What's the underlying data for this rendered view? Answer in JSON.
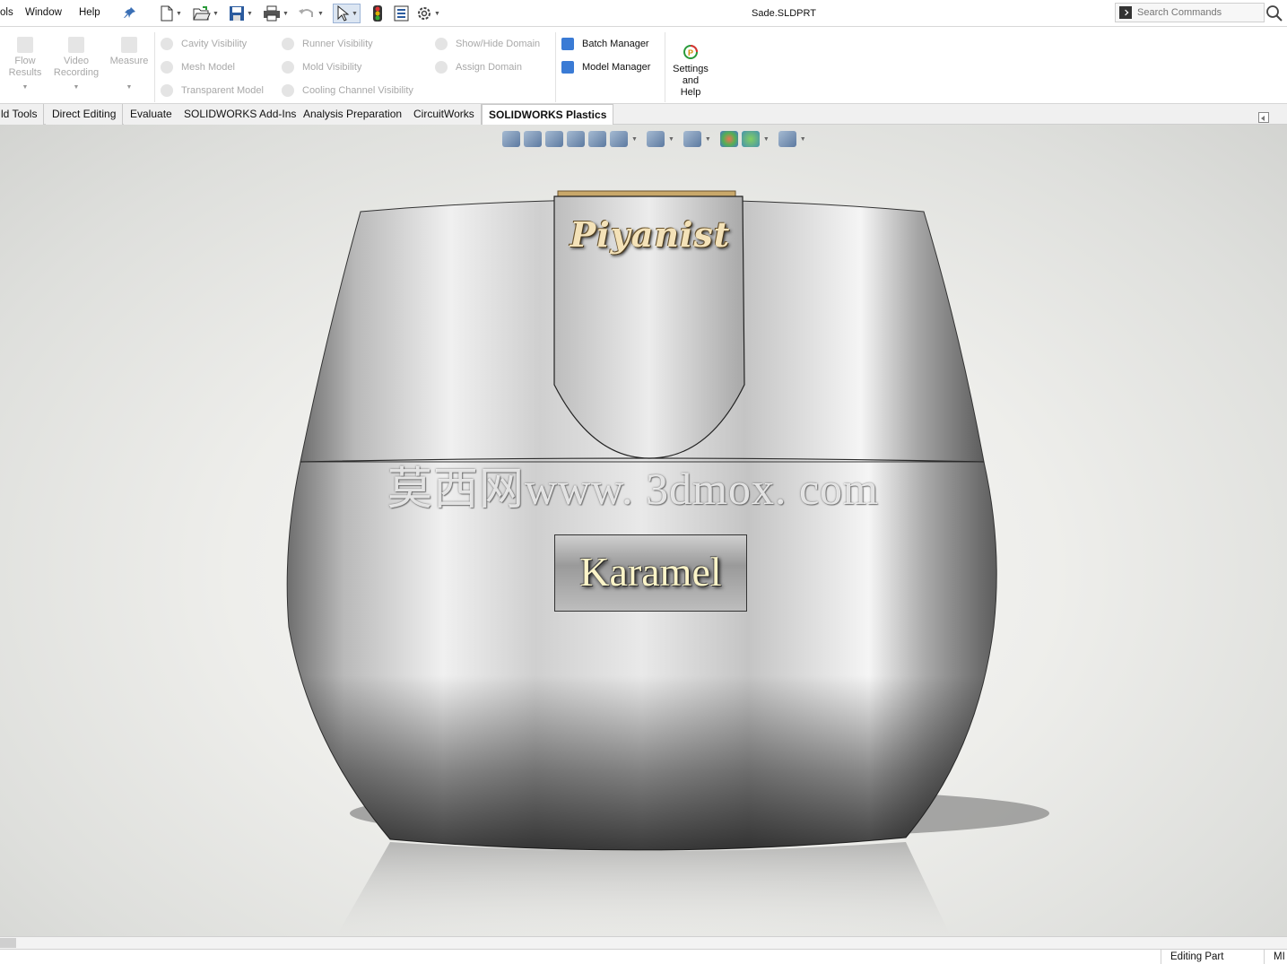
{
  "menu": {
    "tools_fragment": "ols",
    "window": "Window",
    "help": "Help"
  },
  "document": {
    "title": "Sade.SLDPRT"
  },
  "search": {
    "placeholder": "Search Commands"
  },
  "ribbon": {
    "flow_results": [
      "Flow",
      "Results"
    ],
    "video_recording": [
      "Video",
      "Recording"
    ],
    "measure": "Measure",
    "cavity_visibility": "Cavity Visibility",
    "mesh_model": "Mesh Model",
    "transparent_model": "Transparent Model",
    "runner_visibility": "Runner Visibility",
    "mold_visibility": "Mold Visibility",
    "cooling_channel_visibility": "Cooling Channel Visibility",
    "show_hide_domain": "Show/Hide Domain",
    "assign_domain": "Assign Domain",
    "batch_manager": "Batch Manager",
    "model_manager": "Model Manager",
    "settings_and_help": [
      "Settings",
      "and",
      "Help"
    ]
  },
  "tabs": [
    "ld Tools",
    "Direct Editing",
    "Evaluate",
    "SOLIDWORKS Add-Ins",
    "Analysis Preparation",
    "CircuitWorks",
    "SOLIDWORKS Plastics"
  ],
  "active_tab": "SOLIDWORKS Plastics",
  "viewport": {
    "engraving_top": "Piyanist",
    "engraving_front": "Karamel",
    "watermark": "莫西网www. 3dmox. com"
  },
  "status": {
    "mode": "Editing Part",
    "units_fragment": "MI"
  },
  "colors": {
    "accent_blue": "#3a7bd5",
    "label_gold": "#f4e2b8",
    "label_cream": "#fbf4c8"
  }
}
